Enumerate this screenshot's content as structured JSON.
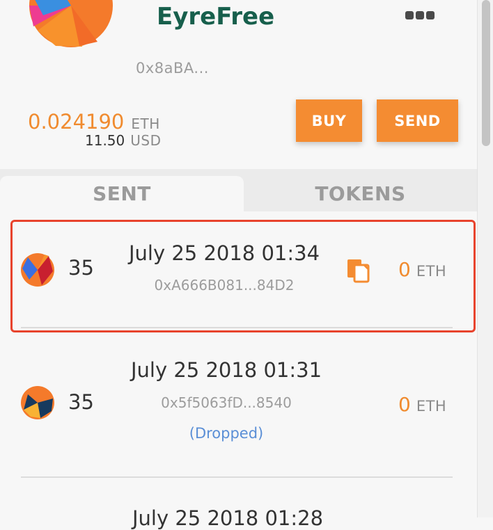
{
  "account": {
    "name": "EyreFree",
    "address": "0x8aBA...",
    "menu_icon": "ellipsis-icon"
  },
  "balance": {
    "eth_amount": "0.024190",
    "eth_unit": "ETH",
    "usd_amount": "11.50",
    "usd_unit": "USD"
  },
  "actions": {
    "buy_label": "BUY",
    "send_label": "SEND"
  },
  "tabs": [
    {
      "label": "SENT",
      "active": true
    },
    {
      "label": "TOKENS",
      "active": false
    }
  ],
  "transactions": [
    {
      "nonce": "35",
      "date": "July 25 2018 01:34",
      "hash": "0xA666B081...84D2",
      "status": "",
      "value": "0",
      "unit": "ETH",
      "highlighted": true,
      "copy_icon": "copy-icon"
    },
    {
      "nonce": "35",
      "date": "July 25 2018 01:31",
      "hash": "0x5f5063fD...8540",
      "status": "(Dropped)",
      "value": "0",
      "unit": "ETH",
      "highlighted": false
    },
    {
      "date": "July 25 2018 01:28"
    }
  ],
  "colors": {
    "accent": "#f48c32",
    "brand_green": "#175f4c",
    "highlight_border": "#e8432d",
    "status_blue": "#5b8fd6"
  }
}
